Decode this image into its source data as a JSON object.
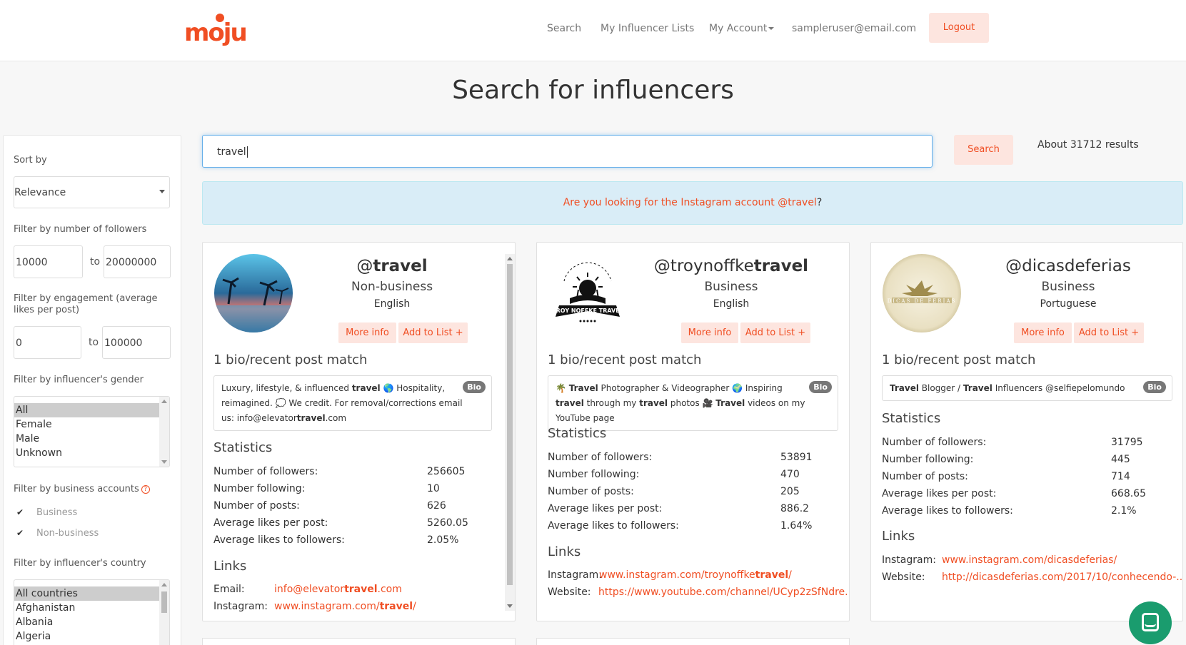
{
  "brand": {
    "name": "moju",
    "accent": "#f04e23"
  },
  "nav": {
    "search": "Search",
    "lists": "My Influencer Lists",
    "account": "My Account",
    "email": "sampleruser@email.com",
    "logout": "Logout"
  },
  "page_title": "Search for influencers",
  "search": {
    "value": "travel",
    "button": "Search",
    "results": "About 31712 results"
  },
  "suggestion": {
    "text": "Are you looking for the Instagram account @travel",
    "q": "?"
  },
  "sidebar": {
    "sort_label": "Sort by",
    "sort_value": "Relevance",
    "followers_label": "Filter by number of followers",
    "followers_min": "10000",
    "followers_max": "20000000",
    "to": "to",
    "engagement_label": "Filter by engagement (average likes per post)",
    "engagement_min": "0",
    "engagement_max": "100000",
    "gender_label": "Filter by influencer's gender",
    "gender_options": [
      "All",
      "Female",
      "Male",
      "Unknown"
    ],
    "business_label": "Filter by business accounts",
    "business_opt": "Business",
    "nonbusiness_opt": "Non-business",
    "country_label": "Filter by influencer's country",
    "country_options": [
      "All countries",
      "Afghanistan",
      "Albania",
      "Algeria"
    ]
  },
  "labels": {
    "more_info": "More info",
    "add_to_list": "Add to List +",
    "statistics": "Statistics",
    "links": "Links",
    "bio_badge": "Bio",
    "followers": "Number of followers:",
    "following": "Number following:",
    "posts": "Number of posts:",
    "avg_likes": "Average likes per post:",
    "avg_ratio": "Average likes to followers:",
    "email": "Email:",
    "instagram": "Instagram:",
    "website": "Website:"
  },
  "cards": [
    {
      "handle_pre": "@",
      "handle_bold": "travel",
      "handle_post": "",
      "type": "Non-business",
      "language": "English",
      "match": "1 bio/recent post match",
      "bio_1": "Luxury, lifestyle, & influenced ",
      "bio_b1": "travel",
      "bio_2": " 🌎 Hospitality, reimagined. 💭 We credit. For removal/corrections email us: info@elevator",
      "bio_b2": "travel",
      "bio_3": ".com",
      "followers": "256605",
      "following": "10",
      "posts": "626",
      "avg_likes": "5260.05",
      "avg_ratio": "2.05%",
      "email_pre": "info@elevator",
      "email_b": "travel",
      "email_post": ".com",
      "insta_pre": "www.instagram.com/",
      "insta_b": "travel",
      "insta_post": "/"
    },
    {
      "handle_pre": "@troynoffke",
      "handle_bold": "travel",
      "handle_post": "",
      "type": "Business",
      "language": "English",
      "match": "1 bio/recent post match",
      "bio_1": "🌴 ",
      "bio_b1": "Travel",
      "bio_2": " Photographer & Videographer 🌍 Inspiring ",
      "bio_b2": "travel",
      "bio_3": " through my ",
      "bio_b3": "travel",
      "bio_4": " photos 🎥 ",
      "bio_b4": "Travel",
      "bio_5": " videos on my YouTube page",
      "followers": "53891",
      "following": "470",
      "posts": "205",
      "avg_likes": "886.2",
      "avg_ratio": "1.64%",
      "insta_pre": "www.instagram.com/troynoffke",
      "insta_b": "travel",
      "insta_post": "/",
      "website": "https://www.youtube.com/channel/UCyp2zSfNdre..."
    },
    {
      "handle_pre": "@dicasdeferias",
      "handle_bold": "",
      "handle_post": "",
      "type": "Business",
      "language": "Portuguese",
      "match": "1 bio/recent post match",
      "bio_b1": "Travel",
      "bio_1": " Blogger / ",
      "bio_b2": "Travel",
      "bio_2": " Influencers @selfiepelomundo",
      "followers": "31795",
      "following": "445",
      "posts": "714",
      "avg_likes": "668.65",
      "avg_ratio": "2.1%",
      "insta": "www.instagram.com/dicasdeferias/",
      "website": "http://dicasdeferias.com/2017/10/conhecendo-..."
    }
  ]
}
